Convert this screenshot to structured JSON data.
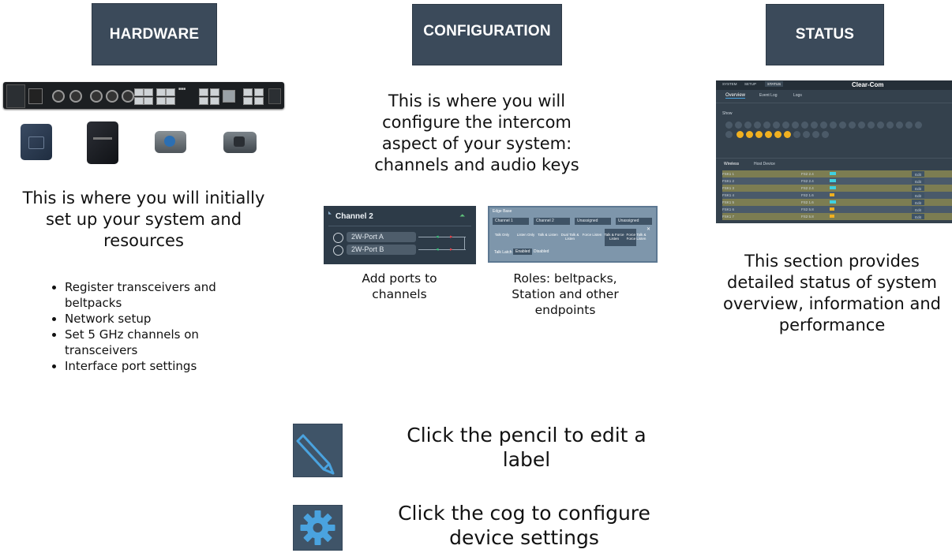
{
  "sections": {
    "hardware": {
      "title": "HARDWARE",
      "description": "This is where you will initially set up your system and resources",
      "bullets": [
        "Register transceivers and beltpacks",
        "Network setup",
        "Set 5 GHz channels on transceivers",
        "Interface port settings"
      ]
    },
    "configuration": {
      "title": "CONFIGURATION",
      "description": "This is where you will configure the intercom aspect of your system: channels and audio keys",
      "channels_caption": "Add ports to channels",
      "roles_caption": "Roles: beltpacks, Station and other endpoints"
    },
    "status": {
      "title": "STATUS",
      "description": "This section provides detailed status of system overview, information and performance"
    }
  },
  "channel_panel": {
    "title": "Channel 2",
    "ports": [
      "2W-Port A",
      "2W-Port B"
    ]
  },
  "roles_panel": {
    "title": "Edge Base",
    "dropdowns": [
      "Channel 1",
      "Channel 2",
      "Unassigned",
      "Unassigned"
    ],
    "roles": [
      "Talk Only",
      "Listen Only",
      "Talk & Listen",
      "Dual Talk & Listen",
      "Force Listen",
      "Talk & Force Listen",
      "Force Talk & Force Listen"
    ],
    "talk_latch_label": "Talk Latch",
    "talk_latch_options": [
      "Enabled",
      "Disabled"
    ]
  },
  "status_panel": {
    "tabs": [
      "SYSTEM",
      "SETUP",
      "STATUS"
    ],
    "brand": "Clear-Com",
    "subtabs": [
      "Overview",
      "Event Log",
      "Logs"
    ],
    "show_label": "Show",
    "subtabs2": [
      "Wireless",
      "Host Device"
    ],
    "rows": [
      "FSK1 1",
      "FSK1 2",
      "FSK1 3",
      "FSK1 4",
      "FSK1 5",
      "FSK1 6",
      "FSK1 7"
    ],
    "row_channels": [
      "FS2 2.4",
      "FS2 2.4",
      "FS2 2.4",
      "FS2 1.6",
      "FS2 1.6",
      "FS2 5.8",
      "FS2 5.8"
    ],
    "edit_label": "Edit"
  },
  "hints": {
    "pencil": "Click the pencil to edit a label",
    "cog": "Click the cog to configure device settings"
  },
  "colors": {
    "tile_bg": "#3b4a5a",
    "icon_bg": "#3f5468",
    "icon_fg": "#4aa3df",
    "port_green": "#39c07a",
    "port_red": "#e2434b",
    "status_dot": "#f0b020"
  }
}
